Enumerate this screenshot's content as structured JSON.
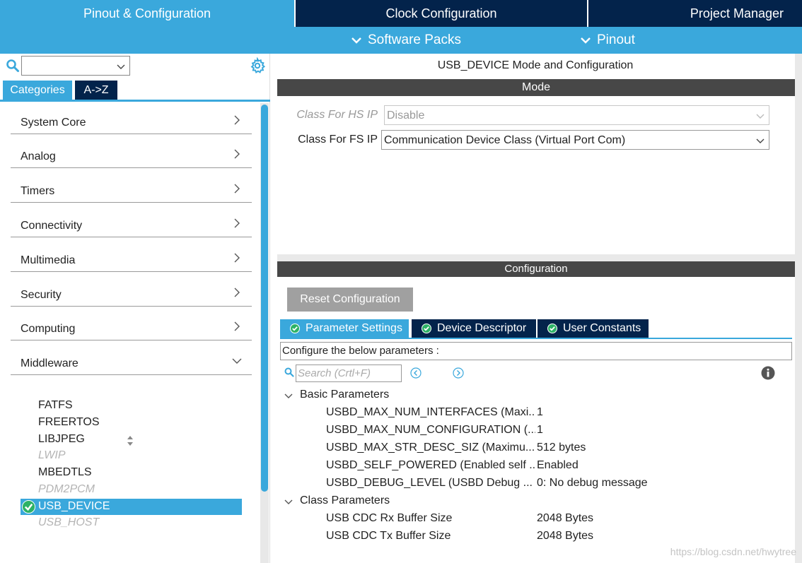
{
  "top_tabs": [
    "Pinout & Configuration",
    "Clock Configuration",
    "Project Manager"
  ],
  "sub_menu": [
    "Software Packs",
    "Pinout"
  ],
  "left": {
    "search_value": "",
    "category_tabs": [
      "Categories",
      "A->Z"
    ],
    "categories": [
      {
        "label": "System Core",
        "expanded": false
      },
      {
        "label": "Analog",
        "expanded": false
      },
      {
        "label": "Timers",
        "expanded": false
      },
      {
        "label": "Connectivity",
        "expanded": false
      },
      {
        "label": "Multimedia",
        "expanded": false
      },
      {
        "label": "Security",
        "expanded": false
      },
      {
        "label": "Computing",
        "expanded": false
      },
      {
        "label": "Middleware",
        "expanded": true
      }
    ],
    "middleware_items": [
      {
        "label": "FATFS",
        "enabled": true
      },
      {
        "label": "FREERTOS",
        "enabled": true
      },
      {
        "label": "LIBJPEG",
        "enabled": true
      },
      {
        "label": "LWIP",
        "enabled": false
      },
      {
        "label": "MBEDTLS",
        "enabled": true
      },
      {
        "label": "PDM2PCM",
        "enabled": false
      },
      {
        "label": "USB_DEVICE",
        "enabled": true,
        "selected": true
      },
      {
        "label": "USB_HOST",
        "enabled": false
      }
    ]
  },
  "mode": {
    "title": "USB_DEVICE Mode and Configuration",
    "section": "Mode",
    "hs_label": "Class For HS IP",
    "hs_value": "Disable",
    "fs_label": "Class For FS IP",
    "fs_value": "Communication Device Class (Virtual Port Com)"
  },
  "config": {
    "section": "Configuration",
    "reset_button": "Reset Configuration",
    "tabs": [
      "Parameter Settings",
      "Device Descriptor",
      "User Constants"
    ],
    "hint": "Configure the below parameters :",
    "search_placeholder": "Search (Crtl+F)",
    "groups": [
      {
        "name": "Basic Parameters",
        "params": [
          {
            "name": "USBD_MAX_NUM_INTERFACES (Maxi...",
            "value": "1"
          },
          {
            "name": "USBD_MAX_NUM_CONFIGURATION (...",
            "value": "1"
          },
          {
            "name": "USBD_MAX_STR_DESC_SIZ (Maximu...",
            "value": "512 bytes"
          },
          {
            "name": "USBD_SELF_POWERED (Enabled self ...",
            "value": "Enabled"
          },
          {
            "name": "USBD_DEBUG_LEVEL (USBD Debug ...",
            "value": "0: No debug message"
          }
        ]
      },
      {
        "name": "Class Parameters",
        "params": [
          {
            "name": "USB CDC Rx Buffer Size",
            "value": "2048 Bytes"
          },
          {
            "name": "USB CDC Tx Buffer Size",
            "value": "2048 Bytes"
          }
        ]
      }
    ]
  },
  "watermark": "https://blog.csdn.net/hwytree",
  "colors": {
    "accent": "#3aa8dc",
    "dark": "#03234b",
    "section": "#474747",
    "check": "#2db266"
  }
}
